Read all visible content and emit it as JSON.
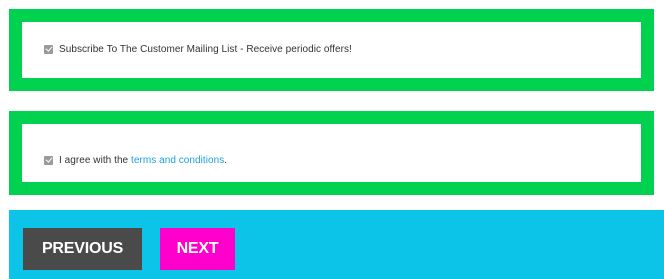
{
  "mailing_list": {
    "checked": true,
    "label": "Subscribe To The Customer Mailing List - Receive periodic offers!"
  },
  "terms": {
    "checked": true,
    "label_prefix": "I agree with the ",
    "link_text": "terms and conditions",
    "label_suffix": "."
  },
  "navigation": {
    "previous_label": "PREVIOUS",
    "next_label": "NEXT"
  },
  "colors": {
    "section_border": "#00d250",
    "footer_background": "#0bc4e8",
    "previous_button": "#4a4a4a",
    "next_button": "#ff00cc",
    "link": "#1fa0d8"
  }
}
